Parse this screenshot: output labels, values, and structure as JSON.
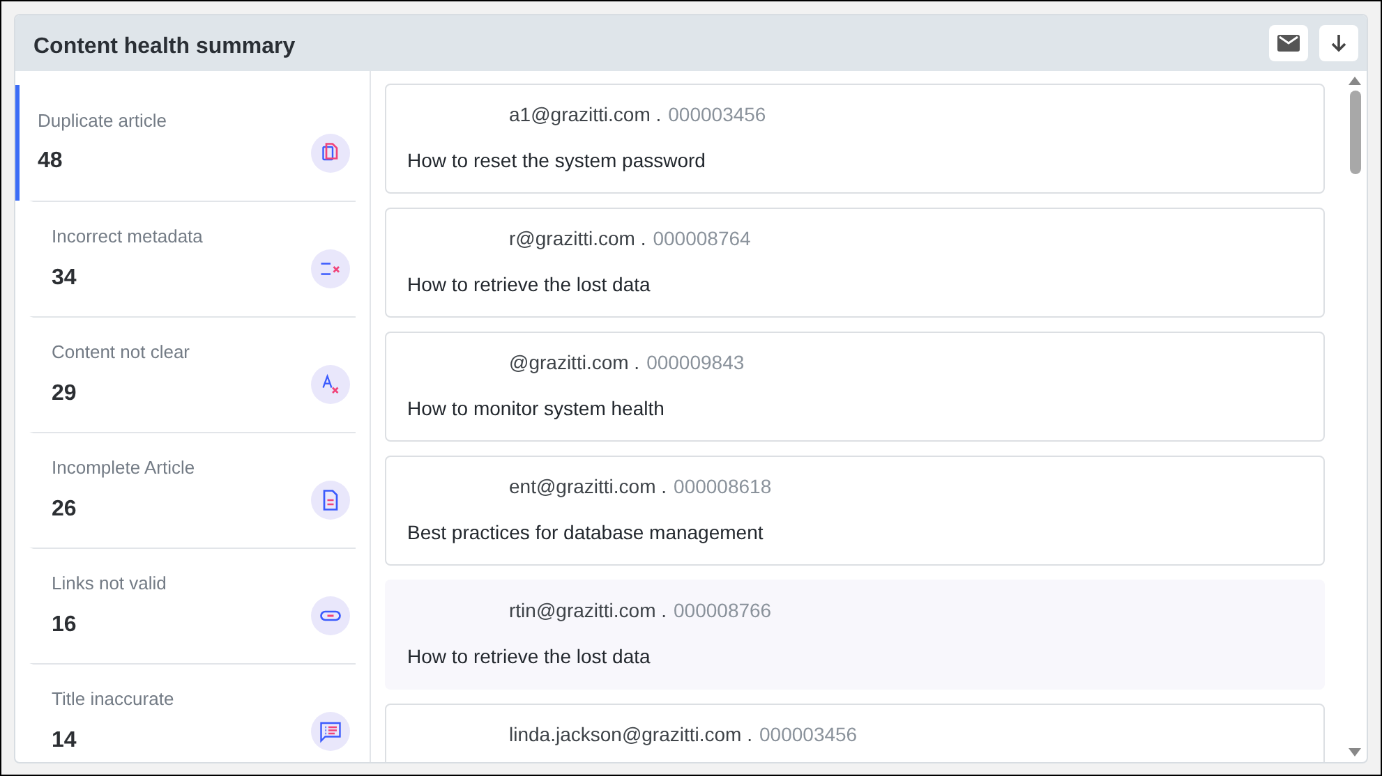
{
  "panel": {
    "title": "Content health summary"
  },
  "sidebar": {
    "items": [
      {
        "label": "Duplicate article",
        "count": "48",
        "selected": true,
        "kind": "duplicate"
      },
      {
        "label": "Incorrect metadata",
        "count": "34",
        "selected": false,
        "kind": "metadata"
      },
      {
        "label": "Content not clear",
        "count": "29",
        "selected": false,
        "kind": "unclear"
      },
      {
        "label": "Incomplete Article",
        "count": "26",
        "selected": false,
        "kind": "incomplete"
      },
      {
        "label": "Links not valid",
        "count": "16",
        "selected": false,
        "kind": "links"
      },
      {
        "label": "Title inaccurate",
        "count": "14",
        "selected": false,
        "kind": "title"
      }
    ]
  },
  "articles": [
    {
      "email": "a1@grazitti.com .",
      "id": "000003456",
      "title": "How to reset the system password",
      "highlighted": false
    },
    {
      "email": "r@grazitti.com .",
      "id": "000008764",
      "title": "How to retrieve the lost data",
      "highlighted": false
    },
    {
      "email": "@grazitti.com .",
      "id": "000009843",
      "title": "How to monitor system health",
      "highlighted": false
    },
    {
      "email": "ent@grazitti.com .",
      "id": "000008618",
      "title": "Best practices for database management",
      "highlighted": false
    },
    {
      "email": "rtin@grazitti.com .",
      "id": "000008766",
      "title": "How to retrieve the lost data",
      "highlighted": true
    },
    {
      "email": "linda.jackson@grazitti.com .",
      "id": "000003456",
      "highlighted": false
    }
  ]
}
